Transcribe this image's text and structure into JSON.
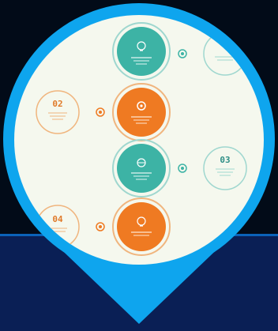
{
  "image": {
    "colors": {
      "background_dark": "#020b18",
      "background_navy": "#0a1f55",
      "divider_blue": "#0b62b8",
      "pin_blue": "#0ea5ee",
      "panel_cream": "#f5f8ee",
      "teal": "#3db3a5",
      "orange": "#ef7a22",
      "outline_teal": "#9fd7cf",
      "outline_orange": "#f0b57e"
    },
    "steps": [
      {
        "number": "",
        "side": "right",
        "color": "teal"
      },
      {
        "number": "02",
        "side": "left",
        "color": "orange"
      },
      {
        "number": "03",
        "side": "right",
        "color": "teal"
      },
      {
        "number": "04",
        "side": "left",
        "color": "orange"
      }
    ],
    "icons": [
      "lightbulb-icon",
      "gear-icon",
      "globe-icon",
      "idea-icon"
    ]
  }
}
